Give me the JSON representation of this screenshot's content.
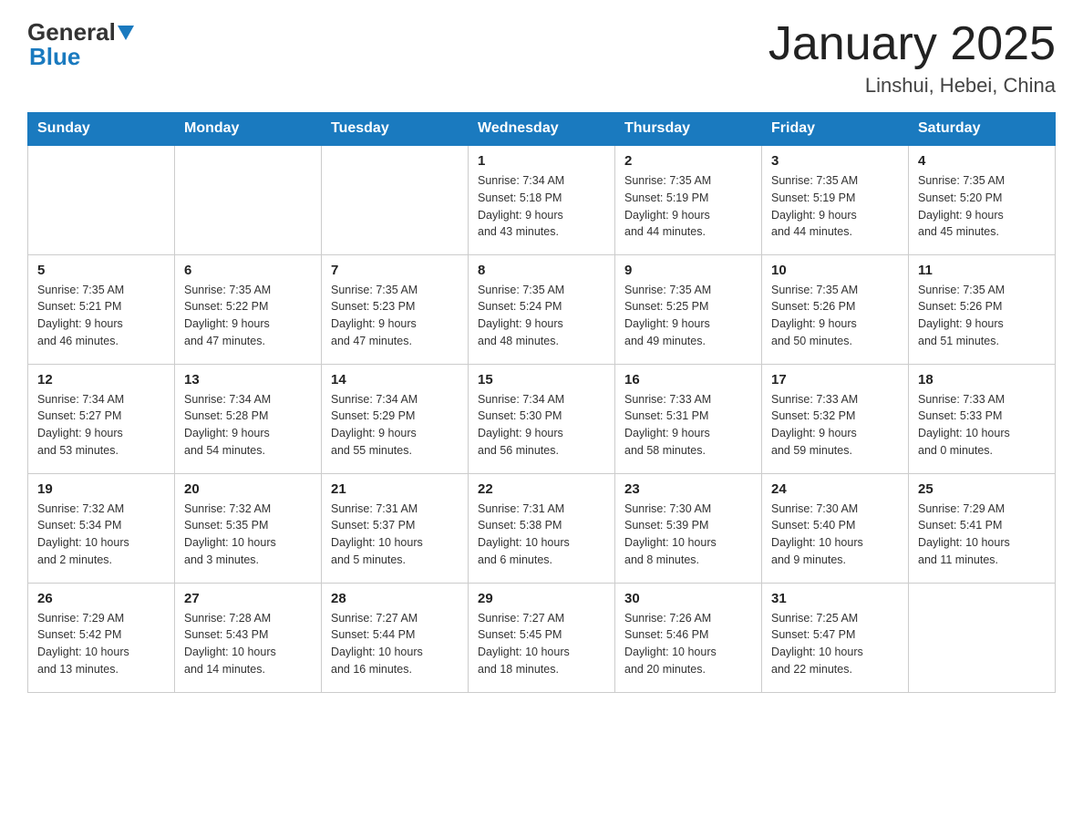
{
  "header": {
    "logo_general": "General",
    "logo_blue": "Blue",
    "title": "January 2025",
    "subtitle": "Linshui, Hebei, China"
  },
  "days_of_week": [
    "Sunday",
    "Monday",
    "Tuesday",
    "Wednesday",
    "Thursday",
    "Friday",
    "Saturday"
  ],
  "weeks": [
    [
      {
        "day": "",
        "info": ""
      },
      {
        "day": "",
        "info": ""
      },
      {
        "day": "",
        "info": ""
      },
      {
        "day": "1",
        "info": "Sunrise: 7:34 AM\nSunset: 5:18 PM\nDaylight: 9 hours\nand 43 minutes."
      },
      {
        "day": "2",
        "info": "Sunrise: 7:35 AM\nSunset: 5:19 PM\nDaylight: 9 hours\nand 44 minutes."
      },
      {
        "day": "3",
        "info": "Sunrise: 7:35 AM\nSunset: 5:19 PM\nDaylight: 9 hours\nand 44 minutes."
      },
      {
        "day": "4",
        "info": "Sunrise: 7:35 AM\nSunset: 5:20 PM\nDaylight: 9 hours\nand 45 minutes."
      }
    ],
    [
      {
        "day": "5",
        "info": "Sunrise: 7:35 AM\nSunset: 5:21 PM\nDaylight: 9 hours\nand 46 minutes."
      },
      {
        "day": "6",
        "info": "Sunrise: 7:35 AM\nSunset: 5:22 PM\nDaylight: 9 hours\nand 47 minutes."
      },
      {
        "day": "7",
        "info": "Sunrise: 7:35 AM\nSunset: 5:23 PM\nDaylight: 9 hours\nand 47 minutes."
      },
      {
        "day": "8",
        "info": "Sunrise: 7:35 AM\nSunset: 5:24 PM\nDaylight: 9 hours\nand 48 minutes."
      },
      {
        "day": "9",
        "info": "Sunrise: 7:35 AM\nSunset: 5:25 PM\nDaylight: 9 hours\nand 49 minutes."
      },
      {
        "day": "10",
        "info": "Sunrise: 7:35 AM\nSunset: 5:26 PM\nDaylight: 9 hours\nand 50 minutes."
      },
      {
        "day": "11",
        "info": "Sunrise: 7:35 AM\nSunset: 5:26 PM\nDaylight: 9 hours\nand 51 minutes."
      }
    ],
    [
      {
        "day": "12",
        "info": "Sunrise: 7:34 AM\nSunset: 5:27 PM\nDaylight: 9 hours\nand 53 minutes."
      },
      {
        "day": "13",
        "info": "Sunrise: 7:34 AM\nSunset: 5:28 PM\nDaylight: 9 hours\nand 54 minutes."
      },
      {
        "day": "14",
        "info": "Sunrise: 7:34 AM\nSunset: 5:29 PM\nDaylight: 9 hours\nand 55 minutes."
      },
      {
        "day": "15",
        "info": "Sunrise: 7:34 AM\nSunset: 5:30 PM\nDaylight: 9 hours\nand 56 minutes."
      },
      {
        "day": "16",
        "info": "Sunrise: 7:33 AM\nSunset: 5:31 PM\nDaylight: 9 hours\nand 58 minutes."
      },
      {
        "day": "17",
        "info": "Sunrise: 7:33 AM\nSunset: 5:32 PM\nDaylight: 9 hours\nand 59 minutes."
      },
      {
        "day": "18",
        "info": "Sunrise: 7:33 AM\nSunset: 5:33 PM\nDaylight: 10 hours\nand 0 minutes."
      }
    ],
    [
      {
        "day": "19",
        "info": "Sunrise: 7:32 AM\nSunset: 5:34 PM\nDaylight: 10 hours\nand 2 minutes."
      },
      {
        "day": "20",
        "info": "Sunrise: 7:32 AM\nSunset: 5:35 PM\nDaylight: 10 hours\nand 3 minutes."
      },
      {
        "day": "21",
        "info": "Sunrise: 7:31 AM\nSunset: 5:37 PM\nDaylight: 10 hours\nand 5 minutes."
      },
      {
        "day": "22",
        "info": "Sunrise: 7:31 AM\nSunset: 5:38 PM\nDaylight: 10 hours\nand 6 minutes."
      },
      {
        "day": "23",
        "info": "Sunrise: 7:30 AM\nSunset: 5:39 PM\nDaylight: 10 hours\nand 8 minutes."
      },
      {
        "day": "24",
        "info": "Sunrise: 7:30 AM\nSunset: 5:40 PM\nDaylight: 10 hours\nand 9 minutes."
      },
      {
        "day": "25",
        "info": "Sunrise: 7:29 AM\nSunset: 5:41 PM\nDaylight: 10 hours\nand 11 minutes."
      }
    ],
    [
      {
        "day": "26",
        "info": "Sunrise: 7:29 AM\nSunset: 5:42 PM\nDaylight: 10 hours\nand 13 minutes."
      },
      {
        "day": "27",
        "info": "Sunrise: 7:28 AM\nSunset: 5:43 PM\nDaylight: 10 hours\nand 14 minutes."
      },
      {
        "day": "28",
        "info": "Sunrise: 7:27 AM\nSunset: 5:44 PM\nDaylight: 10 hours\nand 16 minutes."
      },
      {
        "day": "29",
        "info": "Sunrise: 7:27 AM\nSunset: 5:45 PM\nDaylight: 10 hours\nand 18 minutes."
      },
      {
        "day": "30",
        "info": "Sunrise: 7:26 AM\nSunset: 5:46 PM\nDaylight: 10 hours\nand 20 minutes."
      },
      {
        "day": "31",
        "info": "Sunrise: 7:25 AM\nSunset: 5:47 PM\nDaylight: 10 hours\nand 22 minutes."
      },
      {
        "day": "",
        "info": ""
      }
    ]
  ]
}
